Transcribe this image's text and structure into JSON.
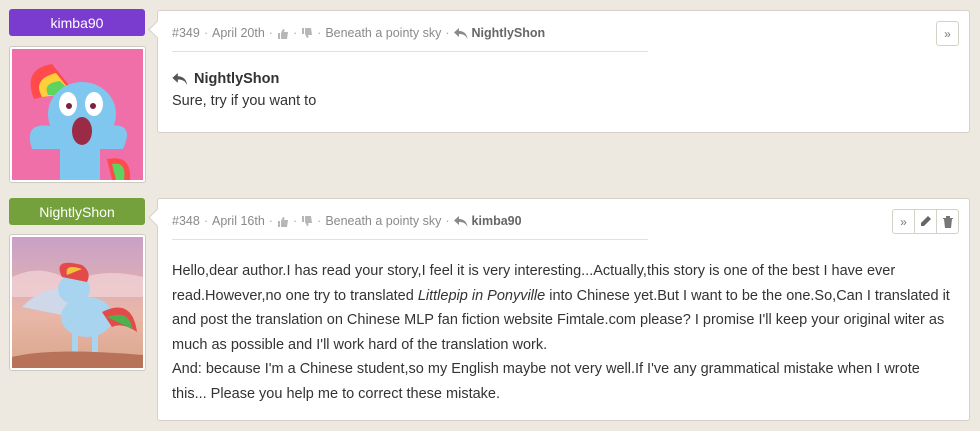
{
  "comments": [
    {
      "author": "kimba90",
      "number": "#349",
      "date": "April 20th",
      "story": "Beneath a pointy sky",
      "reply_to": "NightlyShon",
      "quote_name": "NightlyShon",
      "text": "Sure, try if you want to",
      "actions": [
        "more-icon"
      ]
    },
    {
      "author": "NightlyShon",
      "number": "#348",
      "date": "April 16th",
      "story": "Beneath a pointy sky",
      "reply_to": "kimba90",
      "text_part1": "Hello,dear author.I has read your story,I feel it is very interesting...Actually,this story is one of the best I have ever read.However,no one try to translated ",
      "text_italic": "Littlepip in Ponyville",
      "text_part2": " into Chinese yet.But I want to be the one.So,Can I translated it and post the translation on Chinese MLP fan fiction website Fimtale.com please? I promise I'll keep your original witer as much as possible and I'll work hard of the translation work.",
      "text_line2": "And: because I'm a Chinese student,so my English maybe not very well.If I've any grammatical mistake when I wrote this... Please you help me to correct these mistake.",
      "actions": [
        "more-icon",
        "edit-icon",
        "delete-icon"
      ]
    }
  ],
  "separator": "·",
  "colors": {
    "badge_kimba90": "#7a3ccf",
    "badge_nightlyshon": "#74a13b",
    "background": "#ede9e1"
  }
}
